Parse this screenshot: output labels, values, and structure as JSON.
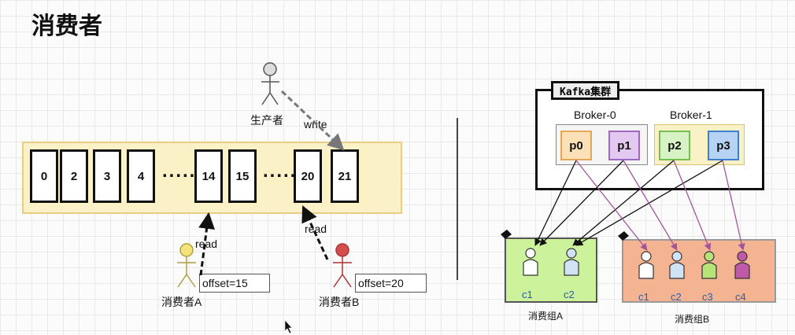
{
  "title": "消费者",
  "producer": {
    "label": "生产者",
    "action": "write"
  },
  "log": {
    "cells": [
      "0",
      "2",
      "3",
      "4",
      "14",
      "15",
      "20",
      "21"
    ],
    "ellipsis": "....."
  },
  "consumers": [
    {
      "label": "消费者A",
      "action": "read",
      "offset": "offset=15",
      "color": "#f4e27a"
    },
    {
      "label": "消费者B",
      "action": "read",
      "offset": "offset=20",
      "color": "#d44c4c"
    }
  ],
  "cluster": {
    "title": "Kafka集群",
    "brokers": [
      {
        "name": "Broker-0",
        "partitions": [
          "p0",
          "p1"
        ]
      },
      {
        "name": "Broker-1",
        "partitions": [
          "p2",
          "p3"
        ]
      }
    ]
  },
  "groups": [
    {
      "label": "消费组A",
      "consumers": [
        "c1",
        "c2"
      ]
    },
    {
      "label": "消费组B",
      "consumers": [
        "c1",
        "c2",
        "c3",
        "c4"
      ]
    }
  ],
  "colors": {
    "p0": "#fce0b8",
    "p1": "#e3c8ef",
    "p2": "#d7f2c4",
    "p3": "#b7d3f3",
    "groupA": "#ccf29c",
    "groupB": "#f5b491",
    "purpleArrow": "#a0569b"
  }
}
